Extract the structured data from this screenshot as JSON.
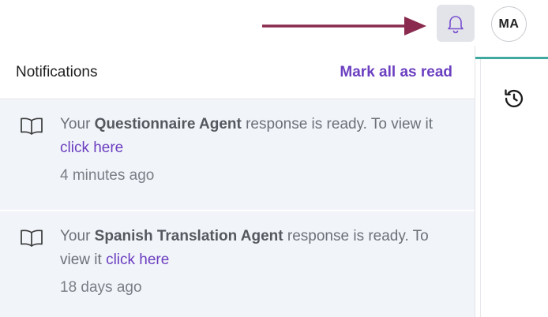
{
  "header": {
    "avatar_initials": "MA",
    "bell_icon": "bell-icon",
    "annotation_arrow_color": "#8a2a4e"
  },
  "panel": {
    "title": "Notifications",
    "mark_all_label": "Mark all as read"
  },
  "notifications": [
    {
      "icon": "book-open-icon",
      "prefix": "Your ",
      "agent": "Questionnaire Agent",
      "middle": " response is ready. To view it ",
      "link": "click here",
      "time": "4 minutes ago"
    },
    {
      "icon": "book-open-icon",
      "prefix": "Your ",
      "agent": "Spanish Translation Agent",
      "middle": " response is ready. To view it ",
      "link": "click here",
      "time": "18 days ago"
    }
  ],
  "colors": {
    "accent": "#6b3fc0",
    "teal": "#3fa9a0",
    "notification_bg": "#f1f4f9"
  }
}
